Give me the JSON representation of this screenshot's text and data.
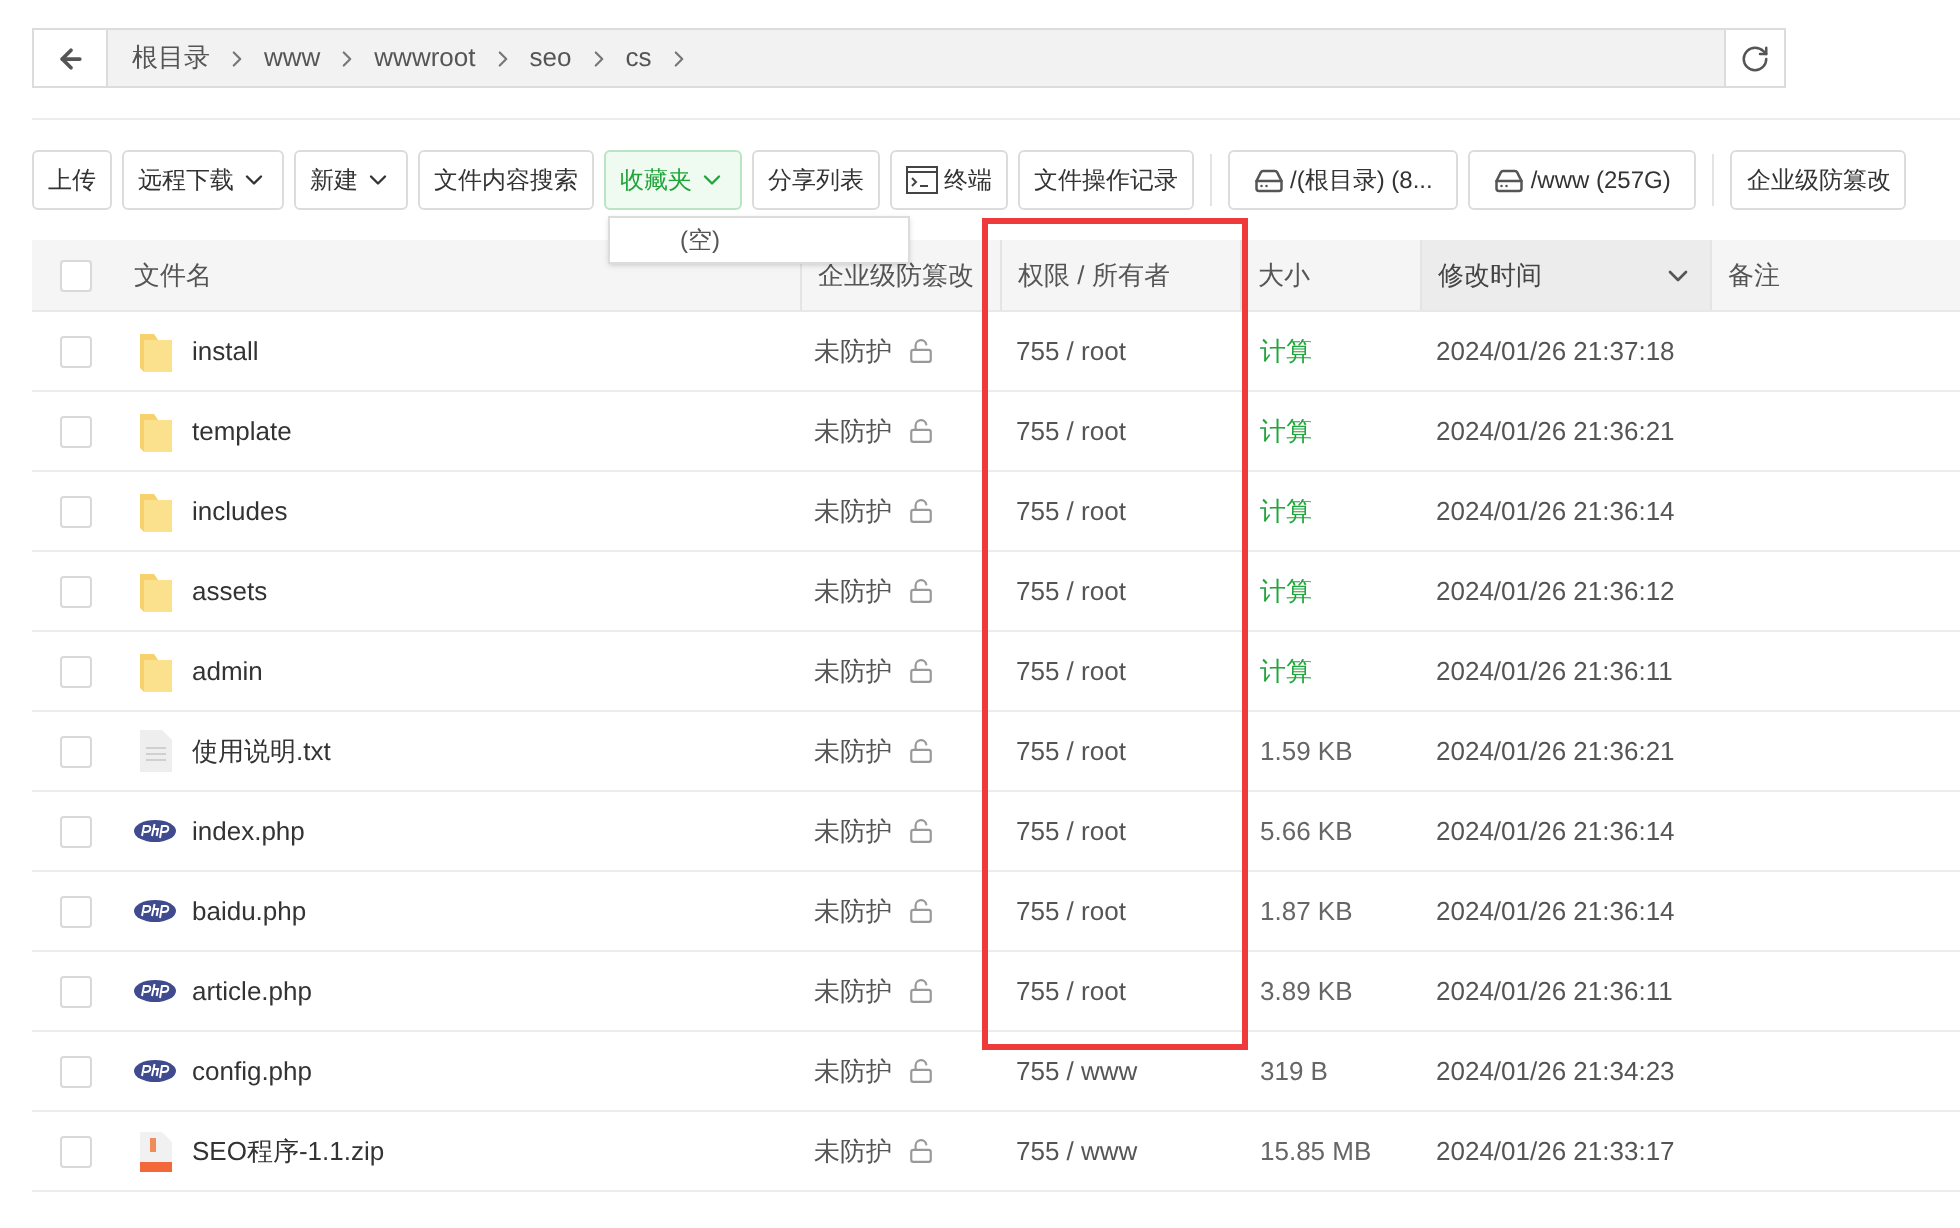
{
  "breadcrumb": {
    "items": [
      "根目录",
      "www",
      "wwwroot",
      "seo",
      "cs"
    ]
  },
  "toolbar": [
    {
      "label": "上传",
      "kind": "plain",
      "selected": false
    },
    {
      "label": "远程下载",
      "kind": "dropdown",
      "selected": false
    },
    {
      "label": "新建",
      "kind": "dropdown",
      "selected": false
    },
    {
      "label": "文件内容搜索",
      "kind": "plain",
      "selected": false
    },
    {
      "label": "收藏夹",
      "kind": "dropdown",
      "selected": true
    },
    {
      "label": "分享列表",
      "kind": "plain",
      "selected": false
    },
    {
      "label": "终端",
      "kind": "terminal",
      "selected": false
    },
    {
      "label": "文件操作记录",
      "kind": "plain",
      "selected": false
    },
    {
      "kind": "divider"
    },
    {
      "label": "/(根目录) (8...",
      "kind": "disk",
      "selected": false
    },
    {
      "label": "/www (257G)",
      "kind": "disk",
      "selected": false
    },
    {
      "kind": "divider"
    },
    {
      "label": "企业级防篡改",
      "kind": "plain",
      "selected": false
    }
  ],
  "favorites_menu": {
    "items": [
      "(空)"
    ]
  },
  "table": {
    "all_checked": false,
    "columns": [
      {
        "label": "文件名",
        "sorted": false
      },
      {
        "label": "企业级防篡改",
        "sorted": false
      },
      {
        "label": "权限 / 所有者",
        "sorted": false
      },
      {
        "label": "大小",
        "sorted": false
      },
      {
        "label": "修改时间",
        "sorted": true
      },
      {
        "label": "备注",
        "sorted": false
      }
    ],
    "rows": [
      {
        "name": "install",
        "kind": "folder",
        "protection": "未防护",
        "permission": "755 / root",
        "size": "计算",
        "size_link": true,
        "modified": "2024/01/26 21:37:18",
        "checked": false
      },
      {
        "name": "template",
        "kind": "folder",
        "protection": "未防护",
        "permission": "755 / root",
        "size": "计算",
        "size_link": true,
        "modified": "2024/01/26 21:36:21",
        "checked": false
      },
      {
        "name": "includes",
        "kind": "folder",
        "protection": "未防护",
        "permission": "755 / root",
        "size": "计算",
        "size_link": true,
        "modified": "2024/01/26 21:36:14",
        "checked": false
      },
      {
        "name": "assets",
        "kind": "folder",
        "protection": "未防护",
        "permission": "755 / root",
        "size": "计算",
        "size_link": true,
        "modified": "2024/01/26 21:36:12",
        "checked": false
      },
      {
        "name": "admin",
        "kind": "folder",
        "protection": "未防护",
        "permission": "755 / root",
        "size": "计算",
        "size_link": true,
        "modified": "2024/01/26 21:36:11",
        "checked": false
      },
      {
        "name": "使用说明.txt",
        "kind": "txt",
        "protection": "未防护",
        "permission": "755 / root",
        "size": "1.59 KB",
        "size_link": false,
        "modified": "2024/01/26 21:36:21",
        "checked": false
      },
      {
        "name": "index.php",
        "kind": "php",
        "protection": "未防护",
        "permission": "755 / root",
        "size": "5.66 KB",
        "size_link": false,
        "modified": "2024/01/26 21:36:14",
        "checked": false
      },
      {
        "name": "baidu.php",
        "kind": "php",
        "protection": "未防护",
        "permission": "755 / root",
        "size": "1.87 KB",
        "size_link": false,
        "modified": "2024/01/26 21:36:14",
        "checked": false
      },
      {
        "name": "article.php",
        "kind": "php",
        "protection": "未防护",
        "permission": "755 / root",
        "size": "3.89 KB",
        "size_link": false,
        "modified": "2024/01/26 21:36:11",
        "checked": false
      },
      {
        "name": "config.php",
        "kind": "php",
        "protection": "未防护",
        "permission": "755 / www",
        "size": "319 B",
        "size_link": false,
        "modified": "2024/01/26 21:34:23",
        "checked": false
      },
      {
        "name": "SEO程序-1.1.zip",
        "kind": "zip",
        "protection": "未防护",
        "permission": "755 / www",
        "size": "15.85 MB",
        "size_link": false,
        "modified": "2024/01/26 21:33:17",
        "checked": false
      }
    ]
  }
}
